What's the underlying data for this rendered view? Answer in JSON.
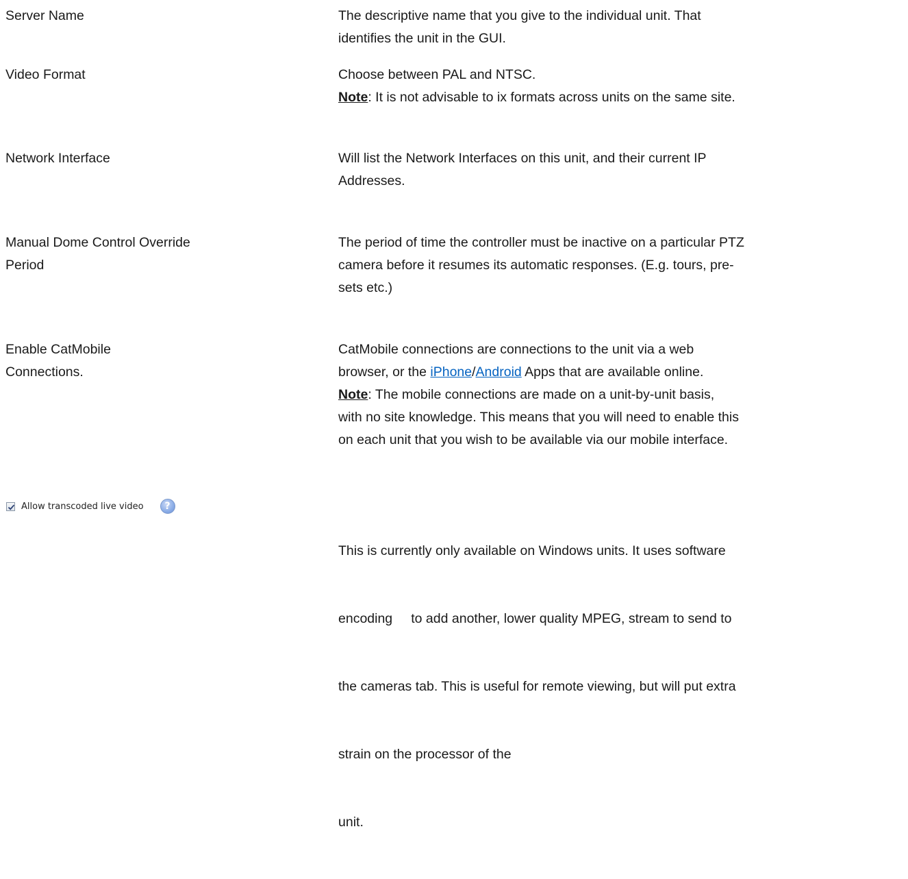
{
  "rows": [
    {
      "term": [
        "Server Name"
      ],
      "desc": [
        "The descriptive name that you give to the individual unit. That",
        "identifies the unit in the GUI."
      ]
    },
    {
      "term": [
        "Video Format"
      ],
      "desc": [
        "Choose between PAL and NTSC."
      ],
      "note_label": "Note",
      "note_text": ": It is not advisable to ix formats across units on the same site."
    },
    {
      "term": [
        "Network Interface"
      ],
      "desc": [
        "Will list the Network Interfaces on this unit, and their current IP",
        "Addresses."
      ]
    },
    {
      "term": [
        "Manual Dome Control Override",
        "Period"
      ],
      "desc": [
        "The period of time the controller must be inactive on a particular PTZ",
        "camera before it resumes its automatic responses. (E.g. tours, pre-",
        "sets etc.)"
      ]
    },
    {
      "term": [
        "Enable CatMobile",
        "Connections."
      ],
      "desc_line1": "CatMobile connections are connections to the unit via a web",
      "desc_line2_before": "browser, or the ",
      "link_iphone": "iPhone",
      "slash": "/",
      "link_android": "Android",
      "desc_line2_after": " Apps that are available online.",
      "note_label": "Note",
      "note_lines": [
        ": The mobile connections are made on a unit-by-unit basis,",
        "with no site knowledge. This means that you will need to enable this",
        "on each unit that you wish to be available via our mobile interface."
      ]
    },
    {
      "checkbox_label": "Allow transcoded live video",
      "checkbox_checked": true,
      "help_icon": "?",
      "desc": [
        "This is currently only available on Windows units. It uses software",
        "encoding     to add another, lower quality MPEG, stream to send to",
        "the cameras tab. This is useful for remote viewing, but will put extra",
        "strain on the processor of the",
        "unit."
      ]
    }
  ]
}
